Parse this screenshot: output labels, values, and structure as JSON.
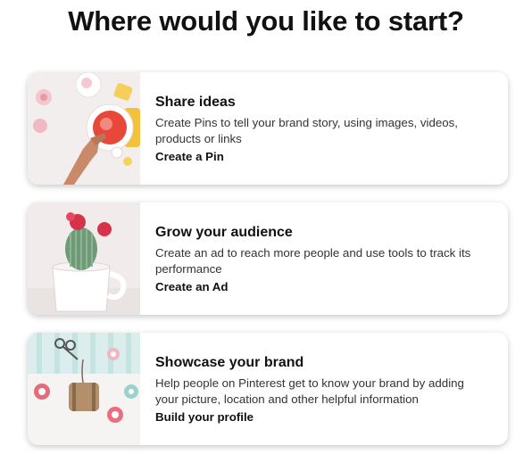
{
  "heading": "Where would you like to start?",
  "cards": [
    {
      "title": "Share ideas",
      "description": "Create Pins to tell your brand story, using images, videos, products or links",
      "action": "Create a Pin"
    },
    {
      "title": "Grow your audience",
      "description": "Create an ad to reach more people and use tools to track its performance",
      "action": "Create an Ad"
    },
    {
      "title": "Showcase your brand",
      "description": "Help people on Pinterest get to know your brand by adding your picture, location and other helpful information",
      "action": "Build your profile"
    }
  ]
}
